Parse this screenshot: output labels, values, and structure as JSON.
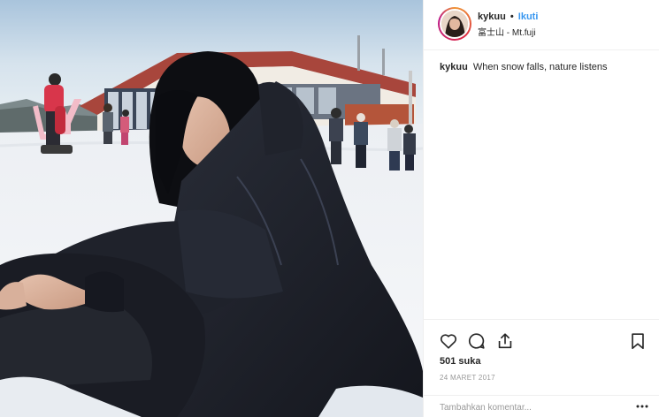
{
  "post": {
    "photo_alt": "",
    "username": "kykuu",
    "separator": "•",
    "follow_label": "Ikuti",
    "location": "富士山 - Mt.fuji",
    "caption_user": "kykuu",
    "caption_text": "When snow falls, nature listens",
    "likes": "501 suka",
    "date": "24 MARET 2017",
    "comment_placeholder": "Tambahkan komentar..."
  },
  "icons": {
    "like": "heart-icon",
    "comment": "comment-icon",
    "share": "share-icon",
    "save": "bookmark-icon",
    "options": "more-options-icon"
  },
  "colors": {
    "follow_blue": "#3897f0",
    "text": "#262626",
    "muted": "#999999",
    "divider": "#efefef"
  }
}
